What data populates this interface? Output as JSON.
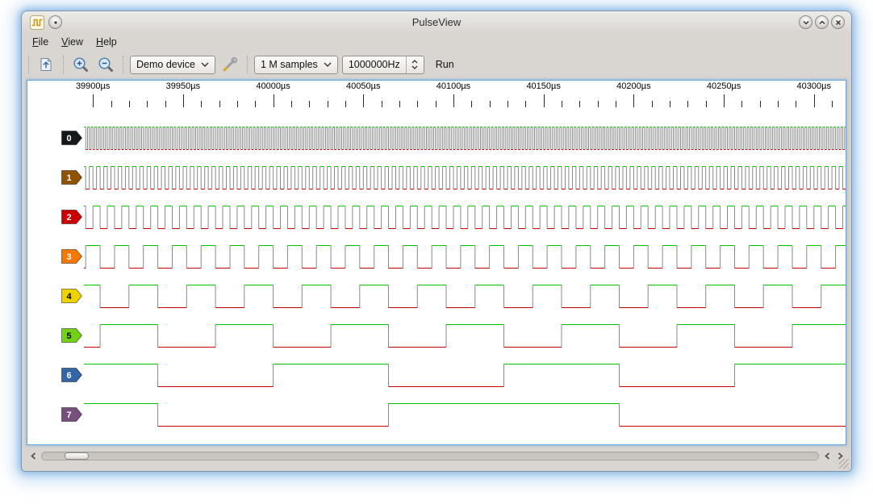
{
  "titlebar": {
    "title": "PulseView"
  },
  "menu": {
    "items": [
      {
        "label": "File"
      },
      {
        "label": "View"
      },
      {
        "label": "Help"
      }
    ]
  },
  "toolbar": {
    "device_combo": {
      "value": "Demo device"
    },
    "samples_combo": {
      "value": "1 M samples"
    },
    "rate_spinbox": {
      "value": "1000000Hz"
    },
    "run_button": {
      "label": "Run"
    },
    "icons": [
      "open-file-icon",
      "zoom-in-icon",
      "zoom-out-icon",
      "probe-config-icon",
      "chevron-down-icon",
      "spin-up-icon",
      "spin-down-icon"
    ]
  },
  "chart_data": {
    "type": "logic-timing-diagram",
    "time_unit": "µs",
    "time_start_us": 39895,
    "time_end_us": 40318,
    "ruler": {
      "major_step_us": 50,
      "minor_step_us": 10,
      "labels": [
        {
          "t": 39900,
          "text": "39900µs"
        },
        {
          "t": 39950,
          "text": "39950µs"
        },
        {
          "t": 40000,
          "text": "40000µs"
        },
        {
          "t": 40050,
          "text": "40050µs"
        },
        {
          "t": 40100,
          "text": "40100µs"
        },
        {
          "t": 40150,
          "text": "40150µs"
        },
        {
          "t": 40200,
          "text": "40200µs"
        },
        {
          "t": 40250,
          "text": "40250µs"
        },
        {
          "t": 40300,
          "text": "40300µs"
        }
      ]
    },
    "pattern": "binary-counter: channel n toggles every 2^n µs; level(t) = floor(t / 2^n) mod 2 (1 = high)",
    "channels": [
      {
        "name": "0",
        "half_period_us": 1,
        "color": "#16191A",
        "label_text_color": "#FFFFFF"
      },
      {
        "name": "1",
        "half_period_us": 2,
        "color": "#8F5202",
        "label_text_color": "#FFFFFF"
      },
      {
        "name": "2",
        "half_period_us": 4,
        "color": "#CC0000",
        "label_text_color": "#FFFFFF"
      },
      {
        "name": "3",
        "half_period_us": 8,
        "color": "#F57900",
        "label_text_color": "#FFFFFF"
      },
      {
        "name": "4",
        "half_period_us": 16,
        "color": "#EDD400",
        "label_text_color": "#000000"
      },
      {
        "name": "5",
        "half_period_us": 32,
        "color": "#73D216",
        "label_text_color": "#000000"
      },
      {
        "name": "6",
        "half_period_us": 64,
        "color": "#3465A4",
        "label_text_color": "#FFFFFF"
      },
      {
        "name": "7",
        "half_period_us": 128,
        "color": "#75507B",
        "label_text_color": "#FFFFFF"
      }
    ],
    "trace_colors": {
      "high": "#00C000",
      "low": "#C00000",
      "edge": "#888888"
    }
  }
}
